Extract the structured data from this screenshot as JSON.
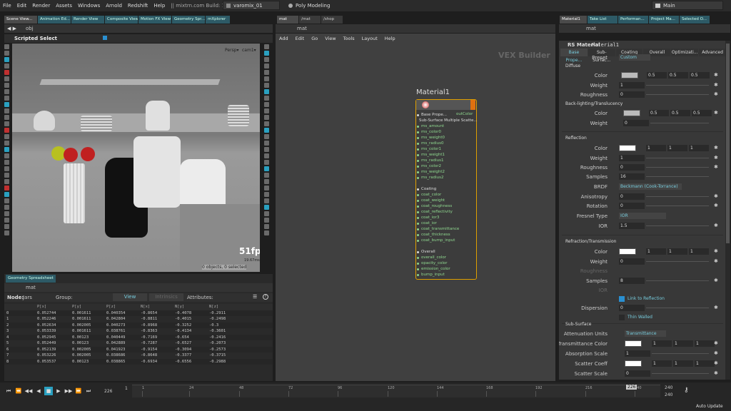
{
  "menu": [
    "File",
    "Edit",
    "Render",
    "Assets",
    "Windows",
    "Arnold",
    "Redshift",
    "Help"
  ],
  "build_info": "|| mixtrn.com  Build: 16.5.505",
  "desk_name": "varomix_01",
  "shelf": "Poly Modeling",
  "main_desk": "Main",
  "left_tabs": [
    "Scene View...",
    "Animation Ed...",
    "Render View",
    "Composite View",
    "Motion FX View",
    "Geometry Spr...",
    "mXplorer"
  ],
  "path_obj": "obj",
  "viewport": {
    "tool": "Scripted Select",
    "persp": "Persp▾",
    "cam": "cam1▾",
    "fps": "51fps",
    "ms": "19.67ms",
    "sel": "0 objects, 0 selected"
  },
  "sheet": {
    "tab": "Geometry Spreadsheet",
    "path": "mat",
    "node_label": "Node:",
    "node": "Jars",
    "group_label": "Group:",
    "view": "View",
    "intrinsics": "Intrinsics",
    "attributes": "Attributes:",
    "headers": [
      "",
      "P[x]",
      "P[y]",
      "P[z]",
      "N[x]",
      "N[y]",
      "N[z]"
    ],
    "rows": [
      [
        "0",
        "0.052744",
        "0.001611",
        "0.040354",
        "-0.8654",
        "-0.4078",
        "-0.2911"
      ],
      [
        "1",
        "0.052246",
        "0.001611",
        "0.042804",
        "-0.8811",
        "-0.4015",
        "-0.2498"
      ],
      [
        "2",
        "0.052634",
        "0.002005",
        "0.040273",
        "-0.8968",
        "-0.3252",
        "-0.3"
      ],
      [
        "3",
        "0.053339",
        "0.001611",
        "0.038761",
        "-0.8363",
        "-0.4134",
        "-0.3601"
      ],
      [
        "4",
        "0.052945",
        "0.00123",
        "0.040449",
        "-0.7169",
        "-0.654",
        "-0.2416"
      ],
      [
        "5",
        "0.052449",
        "0.00123",
        "0.042889",
        "-0.7287",
        "-0.6527",
        "-0.2073"
      ],
      [
        "6",
        "0.052139",
        "0.002005",
        "0.041923",
        "-0.9154",
        "-0.3094",
        "-0.2573"
      ],
      [
        "7",
        "0.053226",
        "0.002005",
        "0.038686",
        "-0.8648",
        "-0.3377",
        "-0.3715"
      ],
      [
        "8",
        "0.053537",
        "0.00123",
        "0.038865",
        "-0.6934",
        "-0.6556",
        "-0.2988"
      ]
    ]
  },
  "net": {
    "tabs": [
      "mat",
      "/mat",
      "/shop"
    ],
    "path": "mat",
    "menu": [
      "Add",
      "Edit",
      "Go",
      "View",
      "Tools",
      "Layout",
      "Help"
    ],
    "watermark": "VEX Builder",
    "node_name": "Material1",
    "ports": [
      [
        "Base Prope...",
        "h"
      ],
      [
        "Sub-Surface Multiple Scatte...",
        "h"
      ],
      [
        "ms_amount",
        ""
      ],
      [
        "ms_color0",
        ""
      ],
      [
        "ms_weight0",
        ""
      ],
      [
        "ms_radius0",
        ""
      ],
      [
        "ms_color1",
        ""
      ],
      [
        "ms_weight1",
        ""
      ],
      [
        "ms_radius1",
        ""
      ],
      [
        "ms_color2",
        ""
      ],
      [
        "ms_weight2",
        ""
      ],
      [
        "ms_radius2",
        ""
      ],
      [
        "",
        ""
      ],
      [
        "Coating",
        "h"
      ],
      [
        "coat_color",
        ""
      ],
      [
        "coat_weight",
        ""
      ],
      [
        "coat_roughness",
        ""
      ],
      [
        "coat_reflectivity",
        ""
      ],
      [
        "coat_ior3",
        ""
      ],
      [
        "coat_ior",
        ""
      ],
      [
        "coat_transmittance",
        ""
      ],
      [
        "coat_thickness",
        ""
      ],
      [
        "coat_bump_input",
        ""
      ],
      [
        "",
        ""
      ],
      [
        "Overall",
        "h"
      ],
      [
        "overall_color",
        ""
      ],
      [
        "opacity_color",
        ""
      ],
      [
        "emission_color",
        ""
      ],
      [
        "bump_input",
        ""
      ]
    ],
    "out": "outColor"
  },
  "props": {
    "tabs": [
      "Material1",
      "Take List",
      "Performan...",
      "Project Ma...",
      "Selected O..."
    ],
    "path": "mat",
    "type": "RS Material",
    "name": "Material1",
    "subtabs": [
      "Base Prope...",
      "Sub-Surfac...",
      "Coating",
      "Overall",
      "Optimizati...",
      "Advanced"
    ],
    "preset_label": "Preset",
    "preset": "Custom",
    "diffuse": "Diffuse",
    "color": "Color",
    "weight": "Weight",
    "roughness": "Roughness",
    "d_color": [
      "0.5",
      "0.5",
      "0.5"
    ],
    "d_weight": "1",
    "d_rough": "0",
    "backlight": "Back-lighting/Translucency",
    "bl_color": [
      "0.5",
      "0.5",
      "0.5"
    ],
    "bl_weight": "0",
    "reflection": "Reflection",
    "r_color": [
      "1",
      "1",
      "1"
    ],
    "r_weight": "1",
    "r_rough": "0",
    "samples": "Samples",
    "r_samples": "16",
    "brdf_label": "BRDF",
    "brdf": "Beckmann (Cook-Torrance)",
    "aniso_label": "Anisotropy",
    "aniso": "0",
    "rot_label": "Rotation",
    "rot": "0",
    "fresnel_label": "Fresnel Type",
    "fresnel": "IOR",
    "ior_label": "IOR",
    "ior": "1.5",
    "refraction": "Refraction/Transmission",
    "t_color": [
      "1",
      "1",
      "1"
    ],
    "t_weight": "0",
    "t_rough": "Roughness",
    "t_samples": "8",
    "t_ior": "IOR",
    "link": "Link to Reflection",
    "disp_label": "Dispersion",
    "disp": "0",
    "thin": "Thin Walled",
    "subsurface": "Sub-Surface",
    "atten_label": "Attenuation Units",
    "atten": "Transmittance",
    "tc_label": "Transmittance Color",
    "tc": [
      "1",
      "1",
      "1"
    ],
    "abs_label": "Absorption Scale",
    "abs": "1",
    "sc_label": "Scatter Coeff",
    "sc": [
      "1",
      "1",
      "1"
    ],
    "ss_label": "Scatter Scale",
    "ss": "0"
  },
  "timeline": {
    "frame": "226",
    "start": "1",
    "ticks": [
      "1",
      "24",
      "48",
      "72",
      "96",
      "120",
      "144",
      "168",
      "192",
      "216",
      "240"
    ],
    "cur": "226",
    "end1": "240",
    "end2": "240",
    "auto": "Auto Update"
  },
  "colors": {
    "accent": "#e0a000",
    "tab": "#2d5a66"
  }
}
